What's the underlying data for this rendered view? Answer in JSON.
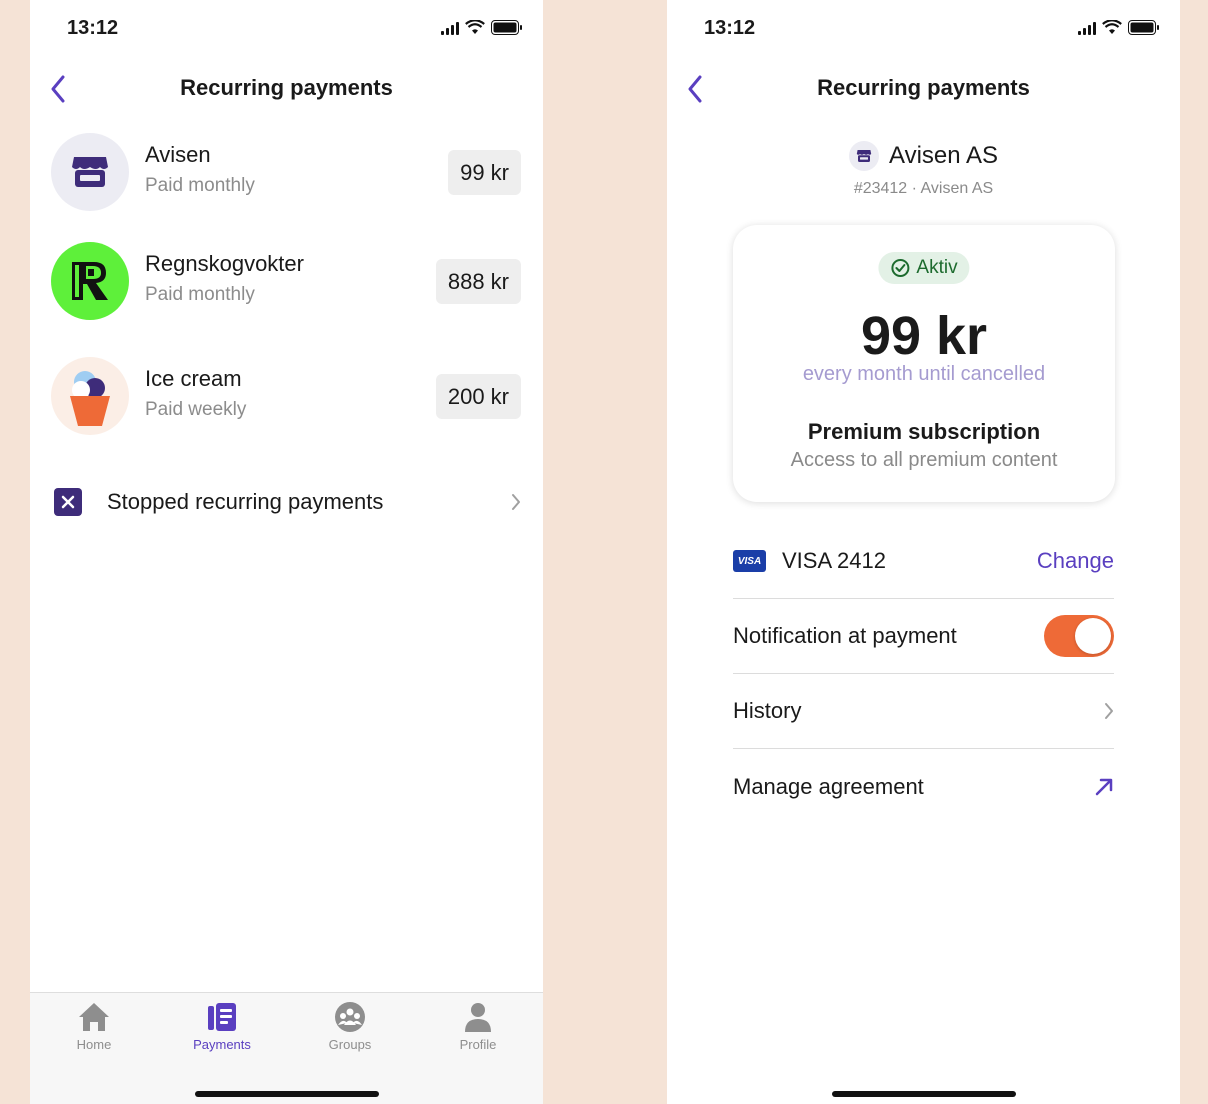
{
  "left_screen": {
    "status_time": "13:12",
    "title": "Recurring payments",
    "payments": [
      {
        "name": "Avisen",
        "frequency": "Paid monthly",
        "amount": "99 kr",
        "icon": "store-icon"
      },
      {
        "name": "Regnskogvokter",
        "frequency": "Paid monthly",
        "amount": "888 kr",
        "icon": "r-logo-icon"
      },
      {
        "name": "Ice cream",
        "frequency": "Paid weekly",
        "amount": "200 kr",
        "icon": "ice-cream-icon"
      }
    ],
    "stopped_label": "Stopped recurring payments",
    "tabs": [
      {
        "label": "Home",
        "icon": "home-icon"
      },
      {
        "label": "Payments",
        "icon": "payments-icon",
        "active": true
      },
      {
        "label": "Groups",
        "icon": "groups-icon"
      },
      {
        "label": "Profile",
        "icon": "profile-icon"
      }
    ]
  },
  "right_screen": {
    "status_time": "13:12",
    "title": "Recurring payments",
    "merchant": {
      "name": "Avisen AS",
      "ref": "#23412 · Avisen AS"
    },
    "card": {
      "status": "Aktiv",
      "amount": "99 kr",
      "frequency": "every month until cancelled",
      "plan_name": "Premium subscription",
      "plan_desc": "Access to all premium content"
    },
    "payment_method": {
      "brand": "VISA",
      "label": "VISA 2412",
      "action": "Change"
    },
    "notification": {
      "label": "Notification at payment",
      "enabled": true
    },
    "history_label": "History",
    "manage_label": "Manage agreement"
  },
  "colors": {
    "background": "#f5e3d6",
    "accent": "#5a3fc0",
    "toggle_on": "#ee6a37",
    "active_badge_bg": "#e3f1e6",
    "active_badge_text": "#1d6b2e"
  }
}
